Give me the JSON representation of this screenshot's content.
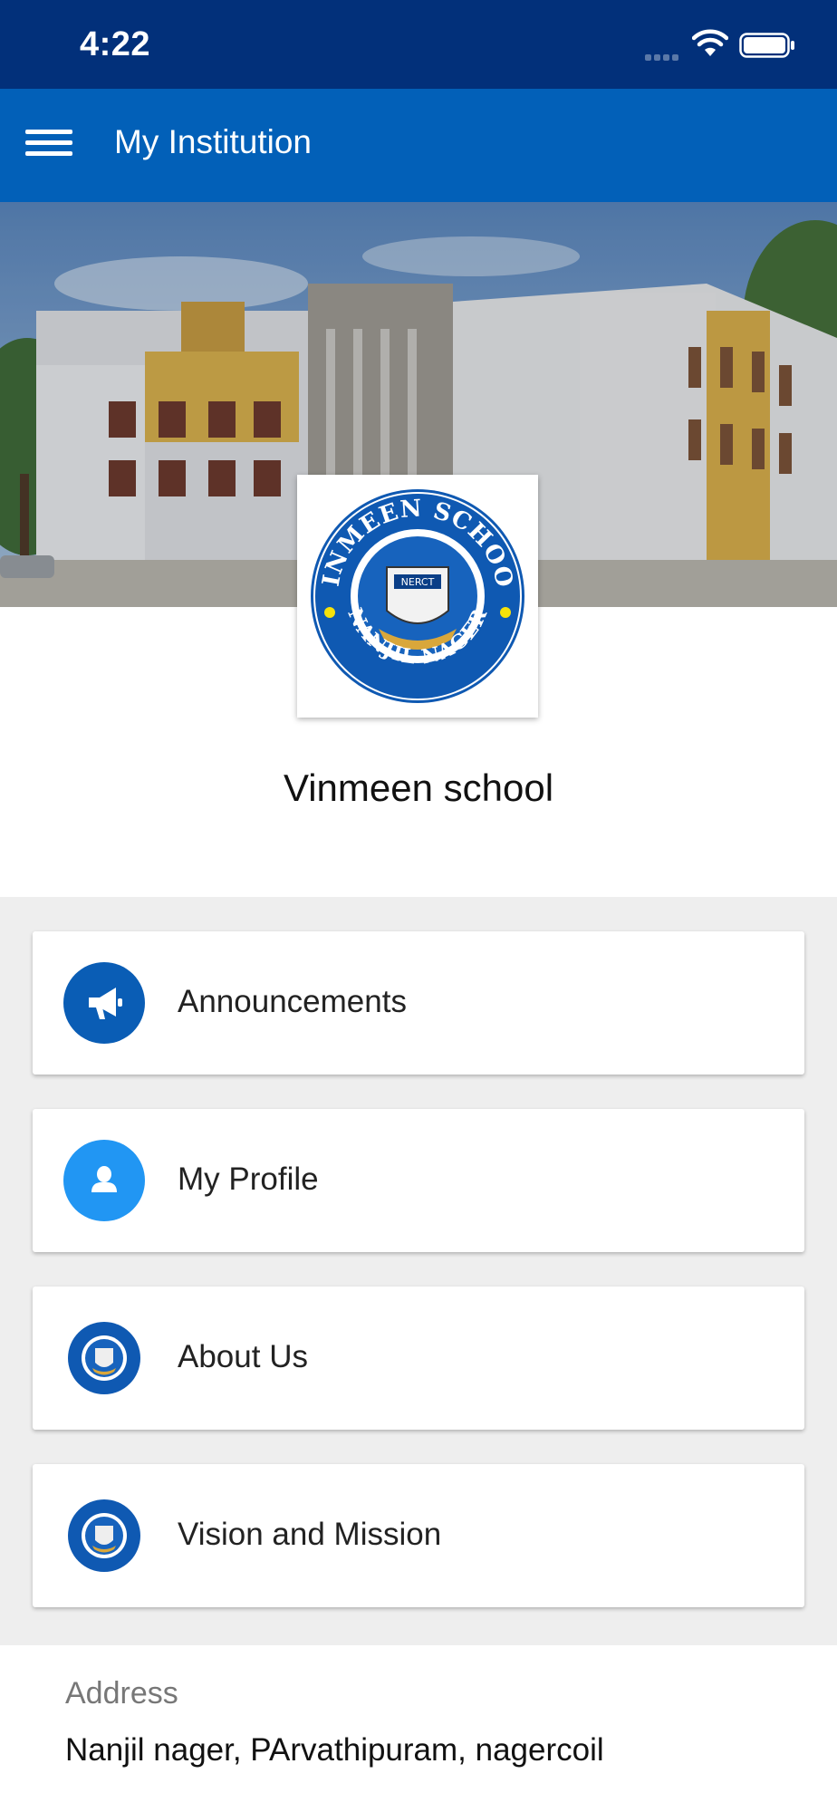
{
  "status_bar": {
    "time": "4:22"
  },
  "app_bar": {
    "title": "My Institution"
  },
  "institution": {
    "name": "Vinmeen school",
    "logo_text_top": "VINMEEN SCHOOL",
    "logo_text_bottom": "NANJIL NAGER",
    "logo_shield_text": "NERCT"
  },
  "menu": [
    {
      "label": "Announcements",
      "icon": "megaphone-icon"
    },
    {
      "label": "My Profile",
      "icon": "person-icon"
    },
    {
      "label": "About Us",
      "icon": "school-logo-icon"
    },
    {
      "label": "Vision and Mission",
      "icon": "school-logo-icon"
    }
  ],
  "address": {
    "label": "Address",
    "value": "Nanjil nager, PArvathipuram, nagercoil"
  },
  "colors": {
    "status_bar": "#02307a",
    "app_bar": "#0260b8",
    "announcement_icon_bg": "#0a5db5",
    "profile_icon_bg": "#2196f3",
    "background": "#eeeeee"
  }
}
